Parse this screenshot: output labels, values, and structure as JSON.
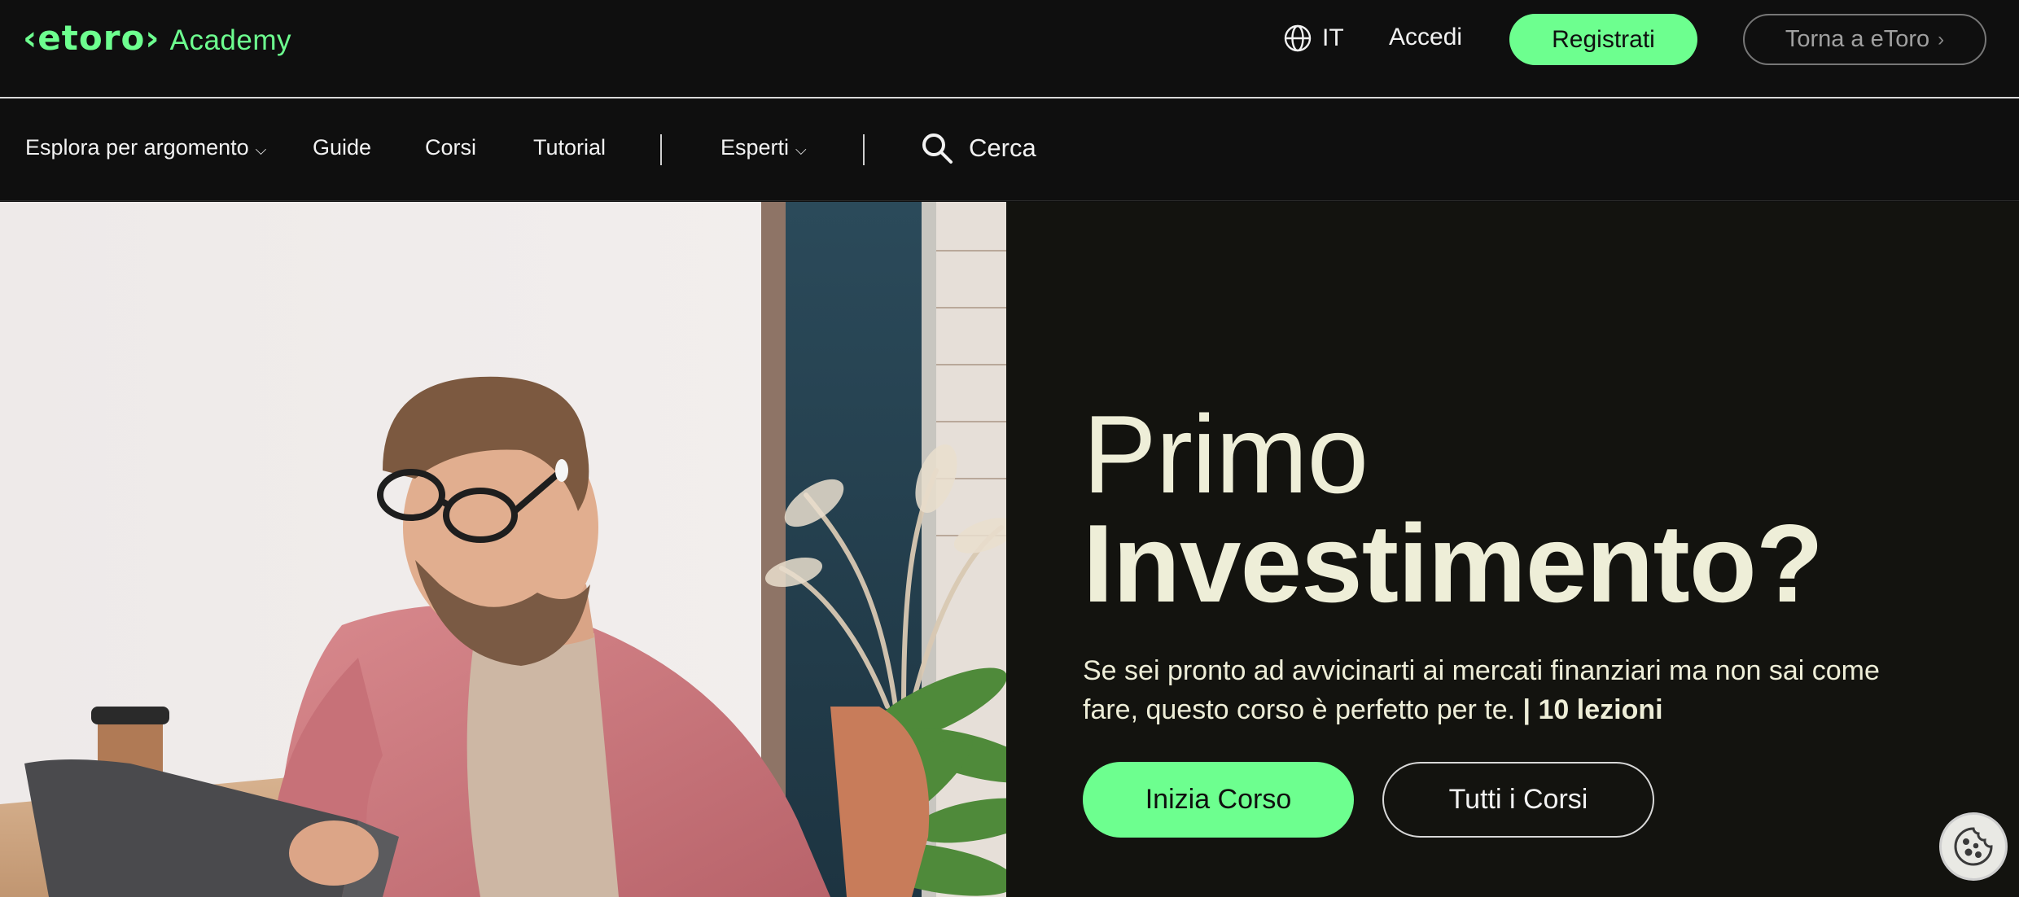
{
  "header": {
    "logo": "‹etoro›",
    "logo_suffix": "Academy",
    "language": "IT",
    "login_label": "Accedi",
    "register_label": "Registrati",
    "back_label": "Torna a eToro",
    "back_chevron": "›"
  },
  "nav": {
    "items": [
      {
        "label": "Esplora per argomento",
        "has_dropdown": true
      },
      {
        "label": "Guide"
      },
      {
        "label": "Corsi"
      },
      {
        "label": "Tutorial"
      },
      {
        "label": "Esperti",
        "has_dropdown": true
      }
    ],
    "caret": "⌵",
    "search_label": "Cerca"
  },
  "hero": {
    "headline_light": "Primo",
    "headline_bold": "Investimento?",
    "description": "Se sei pronto ad avvicinarti ai mercati finanziari ma non sai come fare, questo corso è perfetto per te.",
    "lessons": "| 10 lezioni",
    "primary_button": "Inizia Corso",
    "secondary_button": "Tutti i Corsi"
  },
  "icons": {
    "globe": "globe-icon",
    "search": "search-icon",
    "cookie": "cookie-icon",
    "chevron": "chevron-right-icon"
  },
  "colors": {
    "accent": "#6dff8f",
    "background": "#0f0f0f",
    "hero_panel": "#13130f",
    "headline": "#eeeed8"
  }
}
